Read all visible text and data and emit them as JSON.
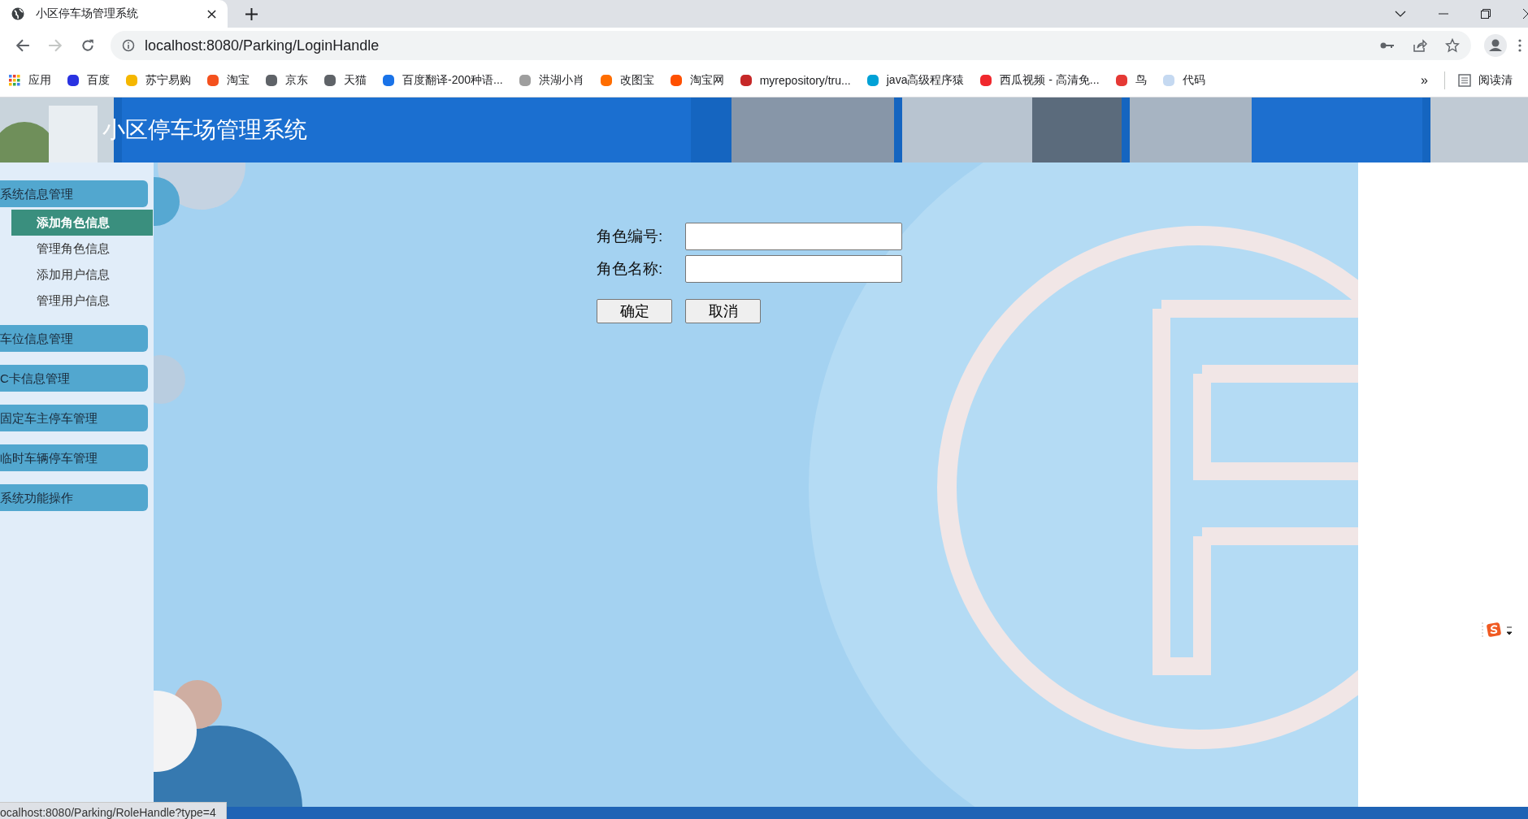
{
  "browser": {
    "tab": {
      "title": "小区停车场管理系统"
    },
    "forward_disabled": true,
    "url": "localhost:8080/Parking/LoginHandle",
    "bookmarks": [
      {
        "label": "应用",
        "kind": "apps"
      },
      {
        "label": "百度",
        "kind": "site",
        "color": "#2932e1"
      },
      {
        "label": "苏宁易购",
        "kind": "site",
        "color": "#f5b700"
      },
      {
        "label": "淘宝",
        "kind": "site",
        "color": "#f4511e"
      },
      {
        "label": "京东",
        "kind": "site",
        "color": "#5f6368"
      },
      {
        "label": "天猫",
        "kind": "site",
        "color": "#5f6368"
      },
      {
        "label": "百度翻译-200种语...",
        "kind": "site",
        "color": "#1a73e8"
      },
      {
        "label": "洪湖小肖",
        "kind": "site",
        "color": "#9e9e9e"
      },
      {
        "label": "改图宝",
        "kind": "site",
        "color": "#ff6d00"
      },
      {
        "label": "淘宝网",
        "kind": "site",
        "color": "#ff5000"
      },
      {
        "label": "myrepository/tru...",
        "kind": "site",
        "color": "#c62828"
      },
      {
        "label": "java高级程序猿",
        "kind": "site",
        "color": "#00a1d6"
      },
      {
        "label": "西瓜视频 - 高清免...",
        "kind": "site",
        "color": "#f0282d"
      },
      {
        "label": "鸟",
        "kind": "site",
        "color": "#e53935"
      },
      {
        "label": "代码",
        "kind": "site",
        "color": "#c5d9f1"
      }
    ],
    "more": "»",
    "reading_list": "阅读清"
  },
  "header": {
    "title": "小区停车场管理系统"
  },
  "sidebar": {
    "menus": [
      {
        "label": "系统信息管理",
        "expanded": true,
        "children": [
          {
            "label": "添加角色信息",
            "selected": true
          },
          {
            "label": "管理角色信息",
            "selected": false
          },
          {
            "label": "添加用户信息",
            "selected": false
          },
          {
            "label": "管理用户信息",
            "selected": false
          }
        ]
      },
      {
        "label": "车位信息管理",
        "expanded": false
      },
      {
        "label": "C卡信息管理",
        "expanded": false
      },
      {
        "label": "固定车主停车管理",
        "expanded": false
      },
      {
        "label": "临时车辆停车管理",
        "expanded": false
      },
      {
        "label": "系统功能操作",
        "expanded": false
      }
    ]
  },
  "form": {
    "fields": [
      {
        "label": "角色编号:"
      },
      {
        "label": "角色名称:"
      }
    ],
    "buttons": [
      "确定",
      "取消"
    ]
  },
  "status_bar": "ocalhost:8080/Parking/RoleHandle?type=4"
}
